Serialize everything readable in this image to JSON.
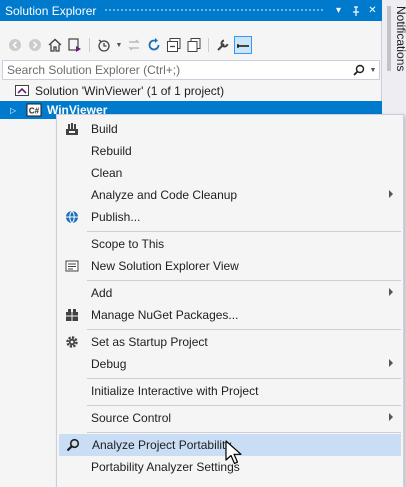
{
  "panel": {
    "title": "Solution Explorer",
    "title_buttons": [
      "▾",
      "⊤",
      "✕"
    ]
  },
  "search": {
    "placeholder": "Search Solution Explorer (Ctrl+;)"
  },
  "tree": {
    "solution_label": "Solution 'WinViewer' (1 of 1 project)",
    "project_label": "WinViewer",
    "project_badge": "C#"
  },
  "sidetab": {
    "label": "Notifications"
  },
  "context_menu": {
    "items": [
      {
        "label": "Build",
        "icon": "build-icon"
      },
      {
        "label": "Rebuild"
      },
      {
        "label": "Clean"
      },
      {
        "label": "Analyze and Code Cleanup",
        "submenu": true
      },
      {
        "label": "Publish...",
        "icon": "globe-icon"
      },
      {
        "label": "Scope to This"
      },
      {
        "label": "New Solution Explorer View",
        "icon": "new-view-icon"
      },
      {
        "label": "Add",
        "submenu": true
      },
      {
        "label": "Manage NuGet Packages...",
        "icon": "nuget-icon"
      },
      {
        "label": "Set as Startup Project",
        "icon": "gear-icon"
      },
      {
        "label": "Debug",
        "submenu": true
      },
      {
        "label": "Initialize Interactive with Project"
      },
      {
        "label": "Source Control",
        "submenu": true
      },
      {
        "label": "Analyze Project Portability",
        "icon": "search-icon",
        "highlighted": true
      },
      {
        "label": "Portability Analyzer Settings"
      }
    ]
  },
  "colors": {
    "accent": "#007acc",
    "menu_hover": "#c9def5",
    "panel_bg": "#f5f5f5"
  }
}
